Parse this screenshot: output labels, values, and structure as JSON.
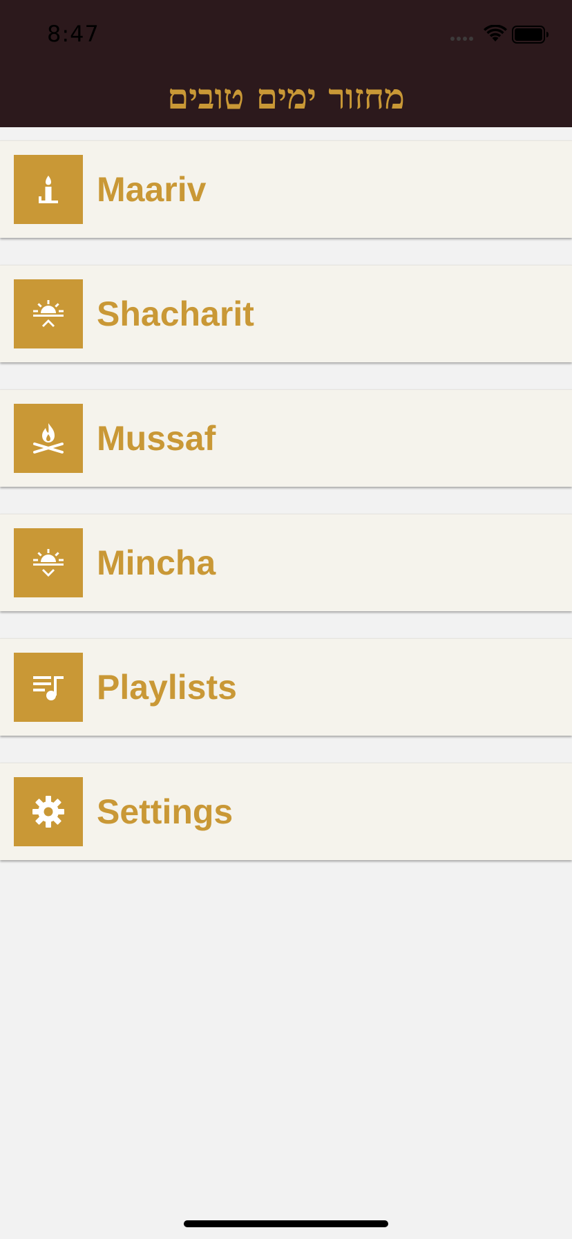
{
  "status_bar": {
    "time": "8:47",
    "wifi_icon": "wifi-icon",
    "battery_icon": "battery-icon"
  },
  "header": {
    "title": "מחזור ימים טובים",
    "background_color": "#2c191c",
    "accent_color": "#c99836"
  },
  "menu": {
    "items": [
      {
        "label": "Maariv",
        "icon": "candle-icon"
      },
      {
        "label": "Shacharit",
        "icon": "sunrise-icon"
      },
      {
        "label": "Mussaf",
        "icon": "fire-icon"
      },
      {
        "label": "Mincha",
        "icon": "sunset-icon"
      },
      {
        "label": "Playlists",
        "icon": "playlist-icon"
      },
      {
        "label": "Settings",
        "icon": "gear-icon"
      }
    ]
  }
}
